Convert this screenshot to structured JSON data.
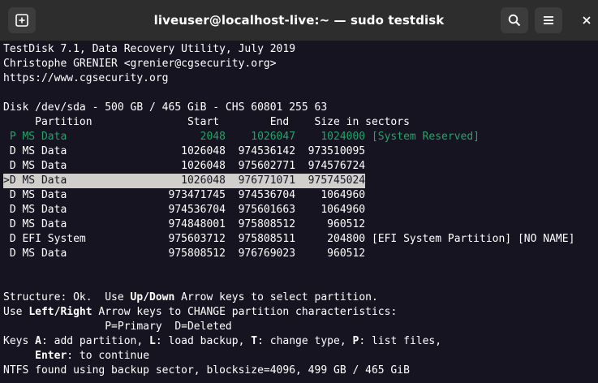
{
  "window": {
    "title": "liveuser@localhost-live:~ — sudo testdisk",
    "new_tab_icon": "new-tab-icon",
    "search_icon": "search-icon",
    "menu_icon": "hamburger-menu-icon",
    "close_icon": "close-icon"
  },
  "colors": {
    "terminal_bg": "#171421",
    "primary_text": "#26a269",
    "selection_bg": "#d0cfcc"
  },
  "terminal": {
    "header": [
      "TestDisk 7.1, Data Recovery Utility, July 2019",
      "Christophe GRENIER <grenier@cgsecurity.org>",
      "https://www.cgsecurity.org"
    ],
    "disk_line": "Disk /dev/sda - 500 GB / 465 GiB - CHS 60801 255 63",
    "columns_line": "     Partition               Start        End    Size in sectors",
    "partitions": [
      " P MS Data                     2048    1026047    1024000 [System Reserved]",
      " D MS Data                  1026048  974536142  973510095",
      " D MS Data                  1026048  975602771  974576724",
      ">D MS Data                  1026048  976771071  975745024",
      " D MS Data                973471745  974536704    1064960",
      " D MS Data                974536704  975601663    1064960",
      " D MS Data                974848001  975808512     960512",
      " D EFI System             975603712  975808511     204800 [EFI System Partition] [NO NAME]",
      " D MS Data                975808512  976769023     960512"
    ],
    "help": {
      "structure_pre": "Structure: Ok.  Use ",
      "structure_key": "Up/Down",
      "structure_post": " Arrow keys to select partition.",
      "use_pre": "Use ",
      "use_key": "Left/Right",
      "use_post": " Arrow keys to CHANGE partition characteristics:",
      "legend": "                P=Primary  D=Deleted",
      "keys_pre": "Keys ",
      "key_a": "A",
      "key_a_text": ": add partition, ",
      "key_l": "L",
      "key_l_text": ": load backup, ",
      "key_t": "T",
      "key_t_text": ": change type, ",
      "key_p": "P",
      "key_p_text": ": list files,",
      "enter_indent": "     ",
      "key_enter": "Enter",
      "enter_text": ": to continue"
    },
    "status": "NTFS found using backup sector, blocksize=4096, 499 GB / 465 GiB"
  }
}
